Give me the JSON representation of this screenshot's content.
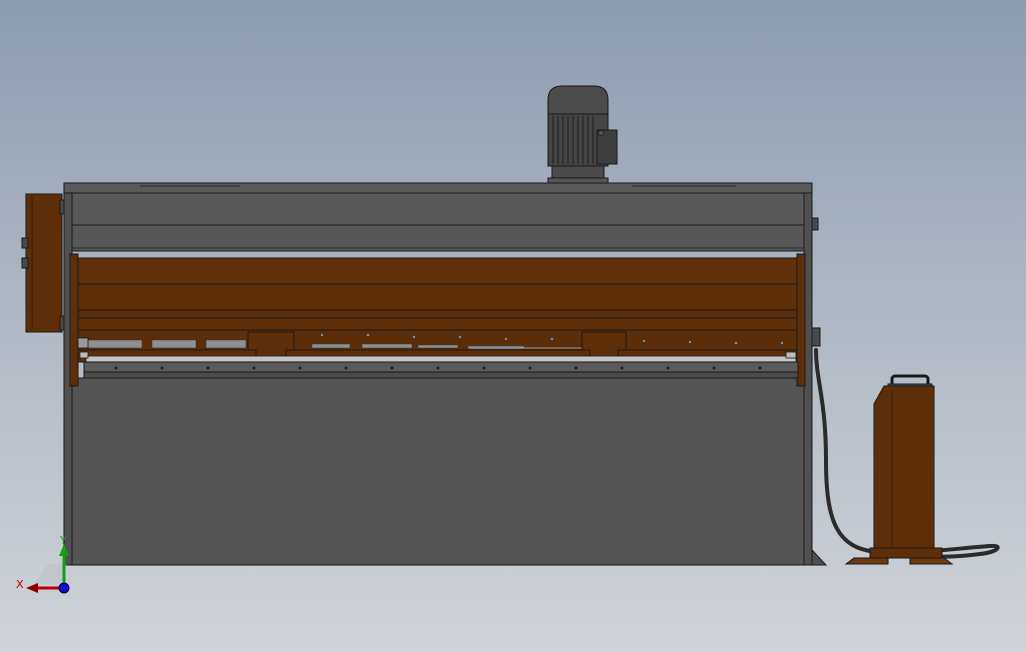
{
  "viewport": {
    "background_top": "#8d9cb0",
    "background_bottom": "#cfd3d8"
  },
  "colors": {
    "frame_gray": "#575757",
    "frame_dark": "#3d3d3d",
    "rust_brown": "#5e2e08",
    "rust_light": "#6e3910",
    "motor_dark": "#4a4a4a",
    "outline": "#1a1a1a",
    "axis_x": "#c00000",
    "axis_y": "#10a010",
    "axis_z": "#1010c0"
  },
  "triad": {
    "x_label": "X",
    "y_label": "Y"
  }
}
